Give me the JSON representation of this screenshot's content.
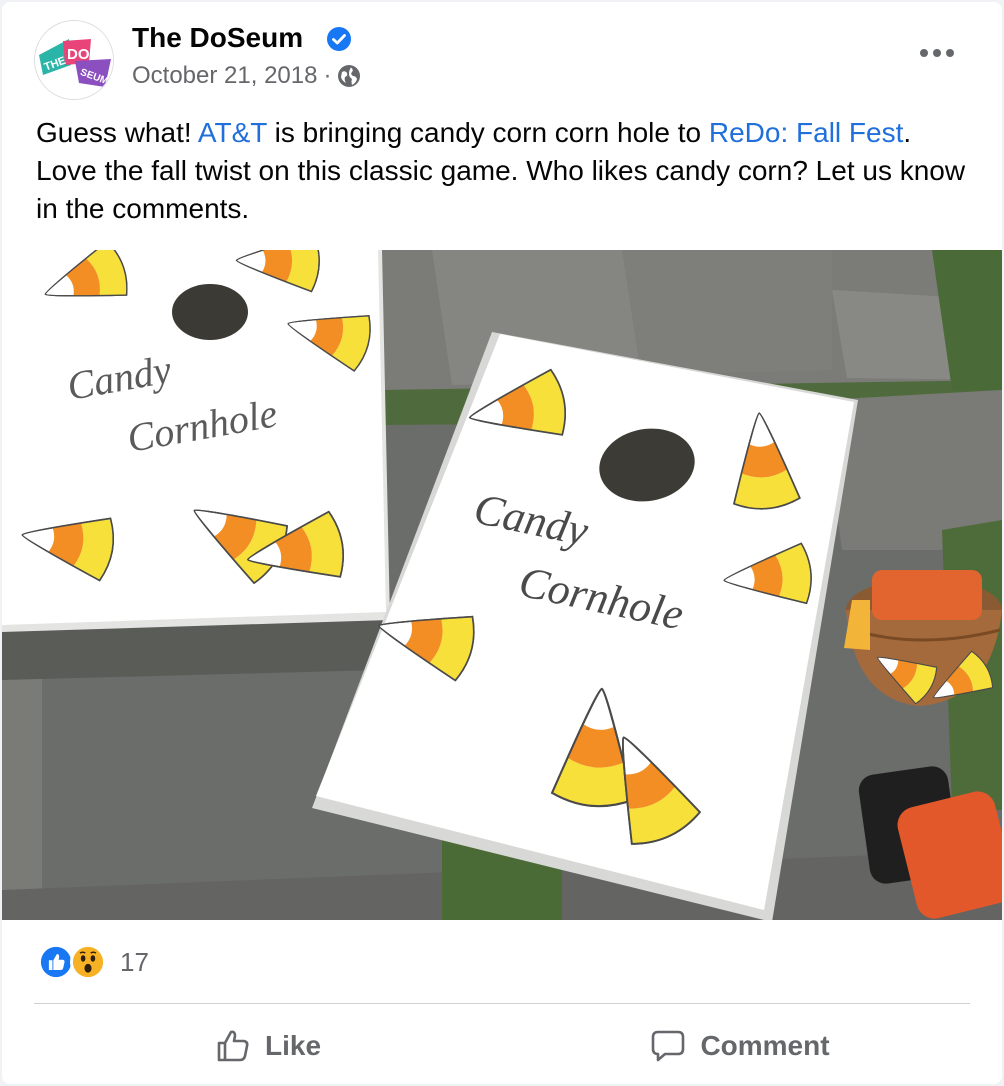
{
  "post": {
    "page_name": "The DoSeum",
    "date": "October 21, 2018",
    "separator": "·",
    "logo_text": {
      "line1": "THE",
      "line2": "DO",
      "line3": "SEUM"
    },
    "text": {
      "p1": "Guess what! ",
      "link1": "AT&T",
      "p2": " is bringing candy corn corn hole to ",
      "link2": "ReDo: Fall Fest",
      "p3": ". Love the fall twist on this classic game. Who likes candy corn? Let us know in the comments."
    },
    "image_text": {
      "left_board_line1": "Candy",
      "left_board_line2": "Cornhole",
      "right_board_line1": "Candy",
      "right_board_line2": "Cornhole"
    },
    "reactions": {
      "count": "17",
      "types": [
        "like",
        "wow"
      ]
    },
    "actions": {
      "like": "Like",
      "comment": "Comment"
    }
  },
  "icons": [
    "verified-badge-icon",
    "globe-icon",
    "more-options-icon",
    "like-reaction-icon",
    "wow-reaction-icon",
    "thumbs-up-icon",
    "comment-bubble-icon"
  ],
  "colors": {
    "link": "#216fdb",
    "verified": "#1877f2",
    "secondary_text": "#65676b",
    "like_reaction": "#1877f2",
    "wow_reaction": "#f7b125"
  }
}
